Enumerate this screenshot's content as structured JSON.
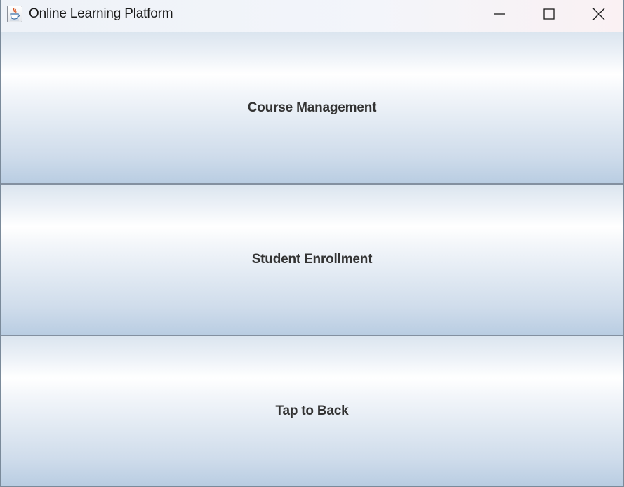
{
  "window": {
    "title": "Online Learning Platform",
    "app_icon": "java-coffee-cup-icon",
    "controls": {
      "minimize_icon": "minimize-icon",
      "maximize_icon": "maximize-icon",
      "close_icon": "close-icon"
    }
  },
  "menu": {
    "buttons": [
      {
        "label": "Course Management"
      },
      {
        "label": "Student Enrollment"
      },
      {
        "label": "Tap to Back"
      }
    ]
  },
  "colors": {
    "button_gradient_top": "#ffffff",
    "button_gradient_bottom": "#b9cde2",
    "label_text": "#333333",
    "separator": "#8390a0"
  }
}
